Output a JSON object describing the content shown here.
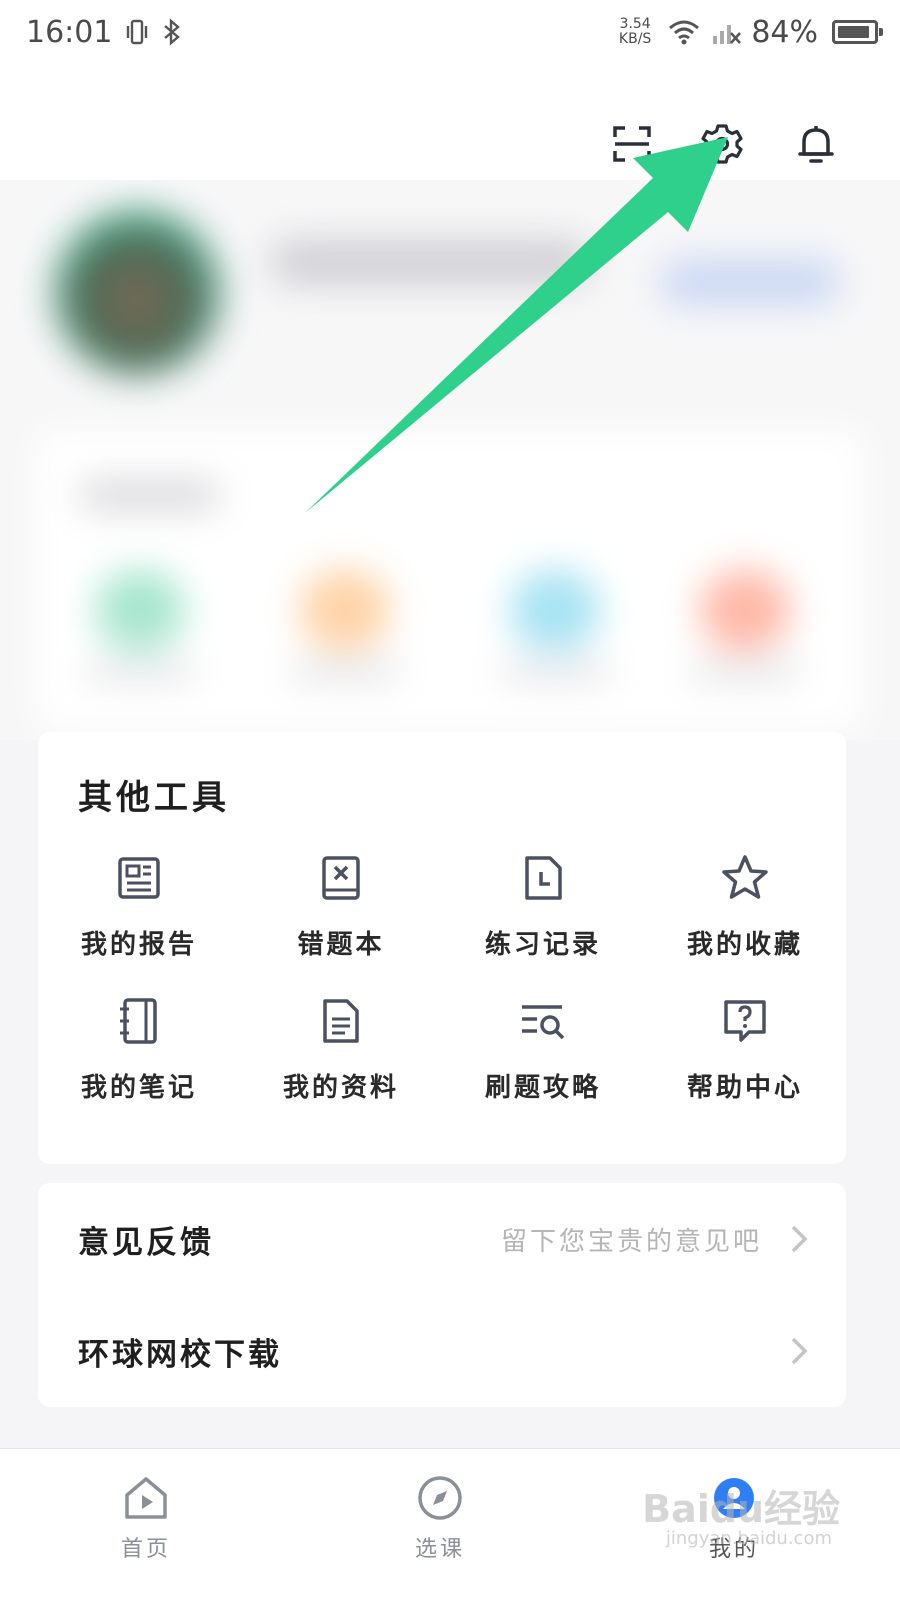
{
  "status_bar": {
    "time": "16:01",
    "net_speed_value": "3.54",
    "net_speed_unit": "KB/S",
    "battery": "84%"
  },
  "top_icons": [
    "scan-icon",
    "settings-gear-icon",
    "notification-bell-icon"
  ],
  "other_tools": {
    "title": "其他工具",
    "items": [
      {
        "label": "我的报告",
        "icon": "report-icon"
      },
      {
        "label": "错题本",
        "icon": "error-book-icon"
      },
      {
        "label": "练习记录",
        "icon": "practice-record-icon"
      },
      {
        "label": "我的收藏",
        "icon": "star-icon"
      },
      {
        "label": "我的笔记",
        "icon": "notebook-icon"
      },
      {
        "label": "我的资料",
        "icon": "document-icon"
      },
      {
        "label": "刷题攻略",
        "icon": "search-list-icon"
      },
      {
        "label": "帮助中心",
        "icon": "help-icon"
      }
    ]
  },
  "menu": {
    "feedback_label": "意见反馈",
    "feedback_hint": "留下您宝贵的意见吧",
    "download_label": "环球网校下载"
  },
  "tab_bar": {
    "tabs": [
      {
        "label": "首页",
        "icon": "home-icon"
      },
      {
        "label": "选课",
        "icon": "compass-icon"
      },
      {
        "label": "我的",
        "icon": "profile-icon"
      }
    ],
    "active": "我的"
  },
  "watermark": {
    "text": "Baidu经验",
    "sub": "jingyan.baidu.com"
  },
  "colors": {
    "accent_arrow": "#2ed08b",
    "icon_gray": "#4b5160",
    "tab_active": "#2f7ef3"
  }
}
